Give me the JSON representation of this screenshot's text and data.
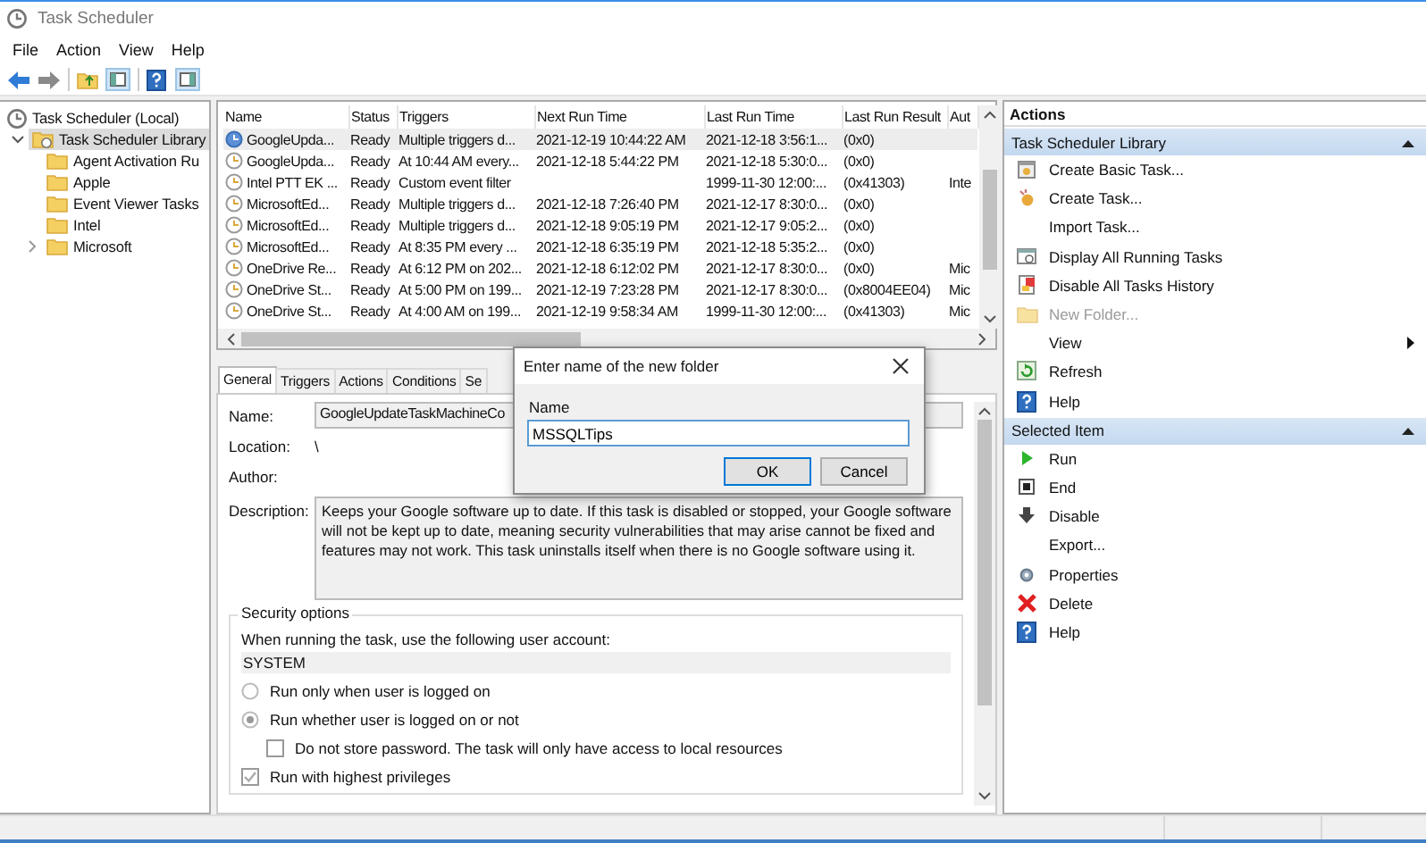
{
  "window": {
    "title": "Task Scheduler"
  },
  "menu": [
    "File",
    "Action",
    "View",
    "Help"
  ],
  "tree": {
    "label": "Task Scheduler (Local)",
    "selected": false,
    "children": [
      {
        "label": "Task Scheduler Library",
        "expanded": true,
        "selected": true,
        "children": [
          {
            "label": "Agent Activation Ru",
            "selected": false
          },
          {
            "label": "Apple",
            "selected": false
          },
          {
            "label": "Event Viewer Tasks",
            "selected": false
          },
          {
            "label": "Intel",
            "selected": false
          },
          {
            "label": "Microsoft",
            "expanded": false,
            "selected": false
          }
        ]
      }
    ]
  },
  "task_list": {
    "columns": [
      "Name",
      "Status",
      "Triggers",
      "Next Run Time",
      "Last Run Time",
      "Last Run Result",
      "Aut"
    ],
    "rows": [
      {
        "selected": true,
        "cells": [
          "GoogleUpda...",
          "Ready",
          "Multiple triggers d...",
          "2021-12-19 10:44:22 AM",
          "2021-12-18 3:56:1...",
          "(0x0)",
          ""
        ]
      },
      {
        "selected": false,
        "cells": [
          "GoogleUpda...",
          "Ready",
          "At 10:44 AM every...",
          "2021-12-18 5:44:22 PM",
          "2021-12-18 5:30:0...",
          "(0x0)",
          ""
        ]
      },
      {
        "selected": false,
        "cells": [
          "Intel PTT EK ...",
          "Ready",
          "Custom event filter",
          "",
          "1999-11-30 12:00:...",
          "(0x41303)",
          "Inte"
        ]
      },
      {
        "selected": false,
        "cells": [
          "MicrosoftEd...",
          "Ready",
          "Multiple triggers d...",
          "2021-12-18 7:26:40 PM",
          "2021-12-17 8:30:0...",
          "(0x0)",
          ""
        ]
      },
      {
        "selected": false,
        "cells": [
          "MicrosoftEd...",
          "Ready",
          "Multiple triggers d...",
          "2021-12-18 9:05:19 PM",
          "2021-12-17 9:05:2...",
          "(0x0)",
          ""
        ]
      },
      {
        "selected": false,
        "cells": [
          "MicrosoftEd...",
          "Ready",
          "At 8:35 PM every ...",
          "2021-12-18 6:35:19 PM",
          "2021-12-18 5:35:2...",
          "(0x0)",
          ""
        ]
      },
      {
        "selected": false,
        "cells": [
          "OneDrive Re...",
          "Ready",
          "At 6:12 PM on 202...",
          "2021-12-18 6:12:02 PM",
          "2021-12-17 8:30:0...",
          "(0x0)",
          "Mic"
        ]
      },
      {
        "selected": false,
        "cells": [
          "OneDrive St...",
          "Ready",
          "At 5:00 PM on 199...",
          "2021-12-19 7:23:28 PM",
          "2021-12-17 8:30:0...",
          "(0x8004EE04)",
          "Mic"
        ]
      },
      {
        "selected": false,
        "cells": [
          "OneDrive St...",
          "Ready",
          "At 4:00 AM on 199...",
          "2021-12-19 9:58:34 AM",
          "1999-11-30 12:00:...",
          "(0x41303)",
          "Mic"
        ]
      }
    ]
  },
  "detail_tabs": [
    {
      "label": "General",
      "selected": true
    },
    {
      "label": "Triggers",
      "selected": false
    },
    {
      "label": "Actions",
      "selected": false
    },
    {
      "label": "Conditions",
      "selected": false
    },
    {
      "label": "Se",
      "selected": false
    }
  ],
  "general": {
    "fields": [
      {
        "kind": "line",
        "label": "Name:",
        "value": "GoogleUpdateTaskMachineCo"
      },
      {
        "kind": "plain",
        "label": "Location:",
        "value": "\\"
      },
      {
        "kind": "plain",
        "label": "Author:"
      },
      {
        "kind": "box",
        "label": "Description:",
        "value": "Keeps your Google software up to date. If this task is disabled or stopped, your Google software will not be kept up to date, meaning security vulnerabilities that may arise cannot be fixed and features may not work. This task uninstalls itself when there is no Google software using it."
      }
    ],
    "security": {
      "title": "Security options",
      "prompt": "When running the task, use the following user account:",
      "account": "SYSTEM",
      "options": [
        {
          "kind": "radio",
          "label": "Run only when user is logged on",
          "selected": false
        },
        {
          "kind": "radio",
          "label": "Run whether user is logged on or not",
          "selected": true,
          "children": [
            {
              "kind": "checkbox",
              "label": "Do not store password.  The task will only have access to local resources",
              "checked": false
            }
          ]
        },
        {
          "kind": "checkbox",
          "label": "Run with highest privileges",
          "checked": true
        }
      ]
    }
  },
  "actions": {
    "title": "Actions",
    "sections": [
      {
        "title": "Task Scheduler Library",
        "expanded": true,
        "items": [
          {
            "kind": "command",
            "label": "Create Basic Task...",
            "disabled": false
          },
          {
            "kind": "command",
            "label": "Create Task...",
            "disabled": false
          },
          {
            "kind": "command",
            "label": "Import Task...",
            "disabled": false
          },
          {
            "kind": "command",
            "label": "Display All Running Tasks",
            "disabled": false
          },
          {
            "kind": "command",
            "label": "Disable All Tasks History",
            "disabled": false
          },
          {
            "kind": "command",
            "label": "New Folder...",
            "disabled": true
          },
          {
            "kind": "submenu",
            "label": "View",
            "disabled": false
          },
          {
            "kind": "command",
            "label": "Refresh",
            "disabled": false
          },
          {
            "kind": "command",
            "label": "Help",
            "disabled": false
          }
        ]
      },
      {
        "title": "Selected Item",
        "expanded": true,
        "items": [
          {
            "kind": "command",
            "label": "Run",
            "disabled": false
          },
          {
            "kind": "command",
            "label": "End",
            "disabled": false
          },
          {
            "kind": "command",
            "label": "Disable",
            "disabled": false
          },
          {
            "kind": "command",
            "label": "Export...",
            "disabled": false
          },
          {
            "kind": "command",
            "label": "Properties",
            "disabled": false
          },
          {
            "kind": "command",
            "label": "Delete",
            "disabled": false
          },
          {
            "kind": "command",
            "label": "Help",
            "disabled": false
          }
        ]
      }
    ]
  },
  "dialog": {
    "title": "Enter name of the new folder",
    "field_label": "Name",
    "value": "MSSQLTips",
    "buttons": [
      {
        "label": "OK",
        "default": true
      },
      {
        "label": "Cancel",
        "default": false
      }
    ]
  }
}
